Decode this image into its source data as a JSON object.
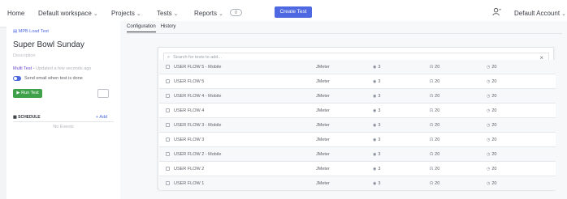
{
  "nav": {
    "home": "Home",
    "workspace": "Default workspace",
    "projects": "Projects",
    "tests": "Tests",
    "reports": "Reports",
    "reports_badge": "0",
    "create_test": "Create Test",
    "account": "Default Account"
  },
  "left": {
    "breadcrumb": "MPB Load Test",
    "title": "Super Bowl Sunday",
    "description_placeholder": "Description",
    "test_type": "Multi Test",
    "updated": "• Updated a few seconds ago",
    "email_label": "Send email when test is done",
    "run_button": "Run Test",
    "schedule_label": "SCHEDULE",
    "add_label": "+ Add",
    "no_events": "No Events"
  },
  "tabs": [
    {
      "label": "Configuration"
    },
    {
      "label": "History"
    }
  ],
  "search": {
    "placeholder": "Search for tests to add..."
  },
  "options": [
    {
      "name": "USER FLOW 5 - Mobile",
      "engine": "JMeter",
      "a": "3",
      "b": "20",
      "c": "20"
    },
    {
      "name": "USER FLOW 5",
      "engine": "JMeter",
      "a": "3",
      "b": "20",
      "c": "20"
    },
    {
      "name": "USER FLOW 4 - Mobile",
      "engine": "JMeter",
      "a": "3",
      "b": "20",
      "c": "20"
    },
    {
      "name": "USER FLOW 4",
      "engine": "JMeter",
      "a": "3",
      "b": "20",
      "c": "20"
    },
    {
      "name": "USER FLOW 3 - Mobile",
      "engine": "JMeter",
      "a": "3",
      "b": "20",
      "c": "20"
    },
    {
      "name": "USER FLOW 3",
      "engine": "JMeter",
      "a": "3",
      "b": "20",
      "c": "20"
    },
    {
      "name": "USER FLOW 2 - Mobile",
      "engine": "JMeter",
      "a": "3",
      "b": "20",
      "c": "20"
    },
    {
      "name": "USER FLOW 2",
      "engine": "JMeter",
      "a": "3",
      "b": "20",
      "c": "20"
    },
    {
      "name": "USER FLOW 1",
      "engine": "JMeter",
      "a": "3",
      "b": "20",
      "c": "20"
    }
  ],
  "colors": {
    "accent": "#4d68e0",
    "run": "#3fa14a"
  }
}
